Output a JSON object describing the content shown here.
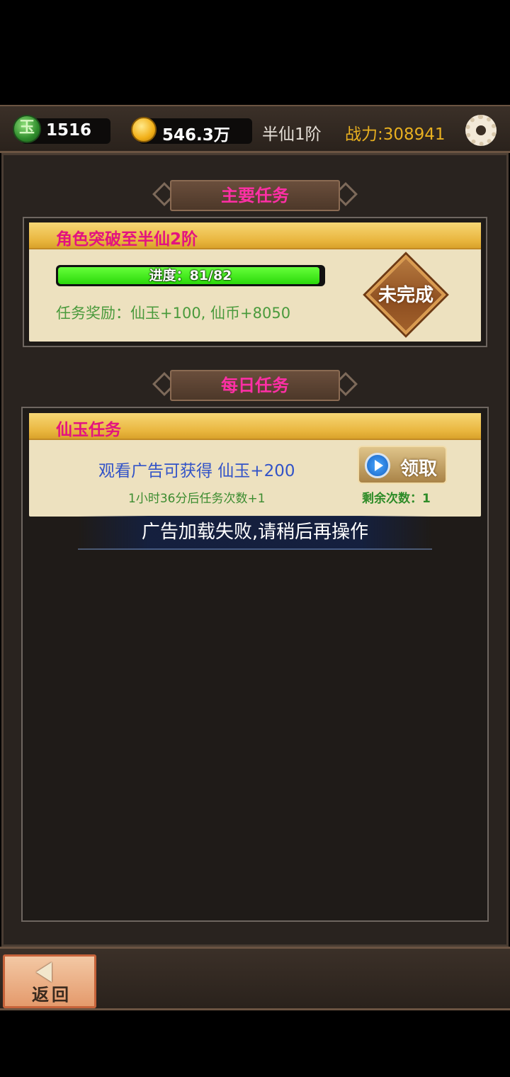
{
  "topbar": {
    "jade_icon": "jade-icon",
    "jade_glyph": "玉",
    "jade_amount": "1516",
    "coin_icon": "coin-icon",
    "coin_amount": "546.3万",
    "realm": "半仙1阶",
    "power": "战力:308941",
    "settings_icon": "gear-icon"
  },
  "main_task": {
    "section_title": "主要任务",
    "title": "角色突破至半仙2阶",
    "progress_text": "进度：81/82",
    "progress_current": 81,
    "progress_total": 82,
    "reward": "任务奖励：仙玉+100, 仙币+8050",
    "status": "未完成"
  },
  "daily": {
    "section_title": "每日任务",
    "task_title": "仙玉任务",
    "description": "观看广告可获得 仙玉+200",
    "timer": "1小时36分后任务次数+1",
    "claim_label": "领取",
    "remaining": "剩余次数：1"
  },
  "toast": "广告加载失败,请稍后再操作",
  "bottom": {
    "back_label": "返回"
  },
  "colors": {
    "accent_pink": "#e3137f",
    "power_gold": "#e8b020",
    "progress_green": "#2bd90a"
  }
}
